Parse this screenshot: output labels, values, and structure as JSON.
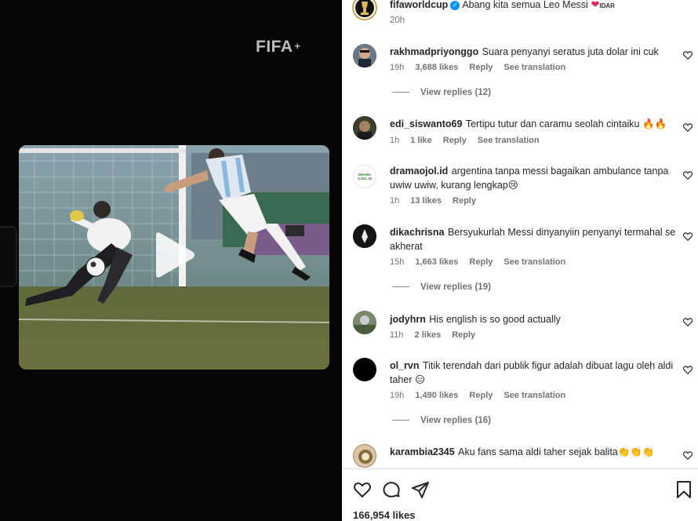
{
  "media": {
    "watermark": "FIFA",
    "watermark_symbol": "+"
  },
  "post": {
    "author": "fifaworldcup",
    "caption": "Abang kita semua Leo Messi",
    "caption_tag": "IDAR",
    "time": "20h"
  },
  "comments": [
    {
      "user": "rakhmadpriyonggo",
      "text": "Suara penyanyi seratus juta dolar ini cuk",
      "time": "19h",
      "likes": "3,688 likes",
      "reply": "Reply",
      "translate": "See translation",
      "view_replies": "View replies (12)"
    },
    {
      "user": "edi_siswanto69",
      "text": "Tertipu tutur dan caramu seolah cintaiku 🔥🔥",
      "time": "1h",
      "likes": "1 like",
      "reply": "Reply",
      "translate": "See translation"
    },
    {
      "user": "dramaojol.id",
      "text": "argentina tanpa messi bagaikan ambulance tanpa uwiw uwiw, kurang lengkap😢",
      "time": "1h",
      "likes": "13 likes",
      "reply": "Reply",
      "avatar_text": "DRAMA OJOL.ID"
    },
    {
      "user": "dikachrisna",
      "text": "Bersyukurlah Messi dinyanyiin penyanyi termahal se akherat",
      "time": "15h",
      "likes": "1,663 likes",
      "reply": "Reply",
      "translate": "See translation",
      "view_replies": "View replies (19)"
    },
    {
      "user": "jodyhrn",
      "text": "His english is so good actually",
      "time": "11h",
      "likes": "2 likes",
      "reply": "Reply"
    },
    {
      "user": "ol_rvn",
      "text": "Titik terendah dari publik figur adalah dibuat lagu oleh aldi taher 😑",
      "time": "19h",
      "likes": "1,490 likes",
      "reply": "Reply",
      "translate": "See translation",
      "view_replies": "View replies (16)"
    },
    {
      "user": "karambia2345",
      "text": "Aku fans sama aldi taher sejak balita👏👏👏"
    }
  ],
  "footer": {
    "likes": "166,954 likes"
  },
  "colors": {
    "heart_red": "#e0245e",
    "verified_blue": "#0095f6",
    "meta_gray": "#737373"
  },
  "icons": [
    "heart-icon",
    "comment-icon",
    "share-icon",
    "bookmark-icon",
    "play-icon",
    "verified-badge-icon"
  ]
}
